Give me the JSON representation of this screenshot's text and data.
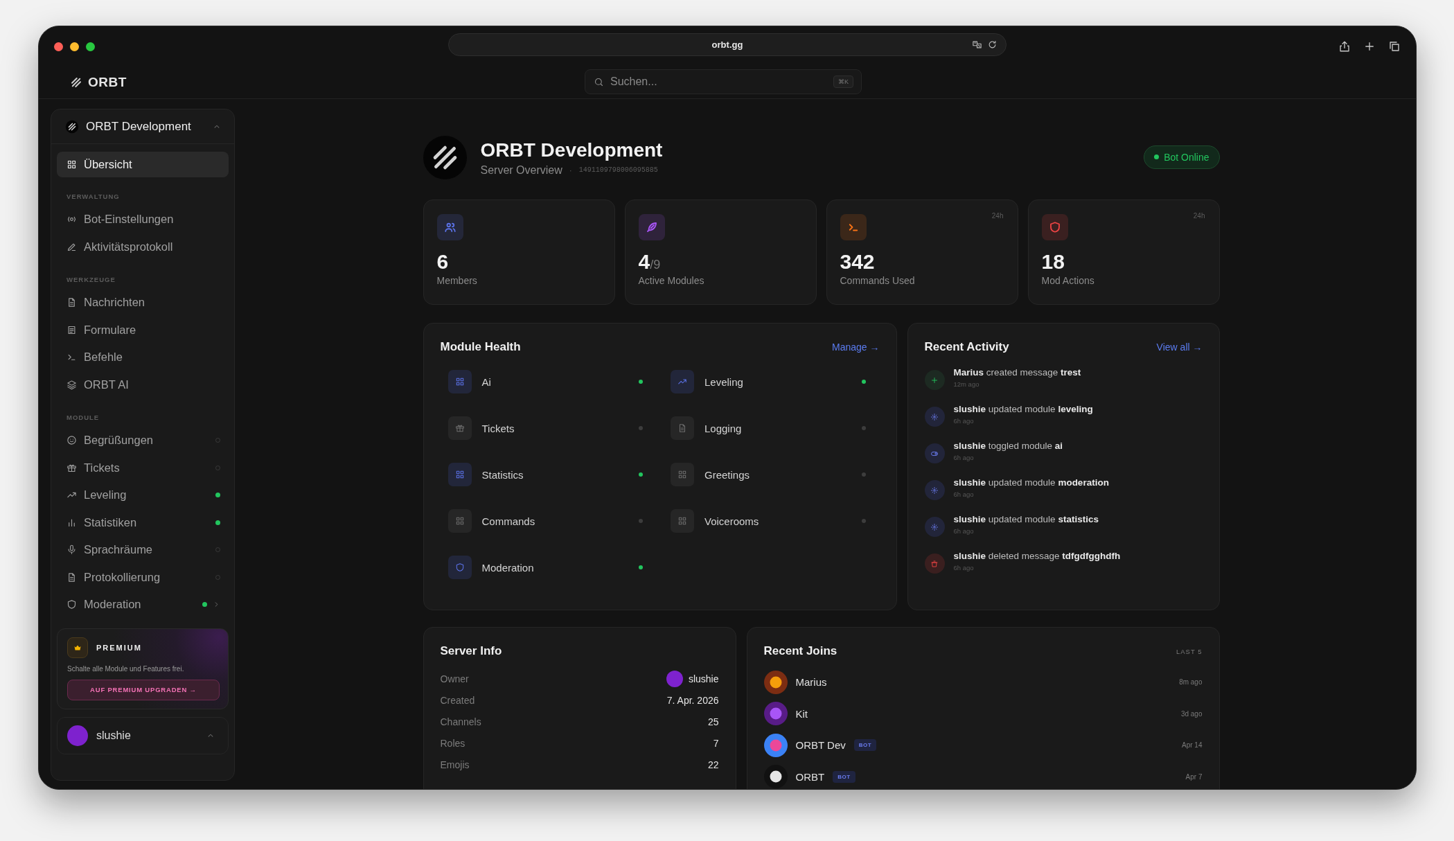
{
  "browser": {
    "url": "orbt.gg"
  },
  "app": {
    "logo": "ORBT",
    "search": {
      "placeholder": "Suchen...",
      "shortcut": "⌘K"
    }
  },
  "sidebar": {
    "server": "ORBT Development",
    "sections": [
      {
        "items": [
          {
            "label": "Übersicht",
            "selected": true
          }
        ]
      },
      {
        "title": "VERWALTUNG",
        "items": [
          {
            "label": "Bot-Einstellungen",
            "selected": false
          },
          {
            "label": "Aktivitätsprotokoll",
            "selected": false
          }
        ]
      },
      {
        "title": "WERKZEUGE",
        "items": [
          {
            "label": "Nachrichten",
            "selected": false
          },
          {
            "label": "Formulare",
            "selected": false
          },
          {
            "label": "Befehle",
            "selected": false
          },
          {
            "label": "ORBT AI",
            "selected": false
          }
        ]
      },
      {
        "title": "MODULE",
        "items": [
          {
            "label": "Begrüßungen",
            "selected": false,
            "active": false,
            "has_submenu": false
          },
          {
            "label": "Tickets",
            "selected": false,
            "active": false,
            "has_submenu": false
          },
          {
            "label": "Leveling",
            "selected": false,
            "active": true,
            "has_submenu": false
          },
          {
            "label": "Statistiken",
            "selected": false,
            "active": true,
            "has_submenu": false
          },
          {
            "label": "Sprachräume",
            "selected": false,
            "active": false,
            "has_submenu": false
          },
          {
            "label": "Protokollierung",
            "selected": false,
            "active": false,
            "has_submenu": false
          },
          {
            "label": "Moderation",
            "selected": false,
            "active": true,
            "has_submenu": true
          }
        ]
      }
    ],
    "premium": {
      "title": "PREMIUM",
      "text": "Schalte alle Module und Features frei.",
      "button": "AUF PREMIUM UPGRADEN →"
    },
    "user": {
      "name": "slushie"
    }
  },
  "header": {
    "title": "ORBT Development",
    "subtitle": "Server Overview",
    "separator": "·",
    "server_id": "1491109798006095885",
    "status": "Bot Online"
  },
  "stats": [
    {
      "value": "6",
      "label": "Members",
      "color": "#5b72e8"
    },
    {
      "value": "4",
      "suffix": "/9",
      "label": "Active Modules",
      "color": "#a855f7"
    },
    {
      "value": "342",
      "label": "Commands Used",
      "color": "#f97316",
      "period": "24h"
    },
    {
      "value": "18",
      "label": "Mod Actions",
      "color": "#ef4444",
      "period": "24h"
    }
  ],
  "module_health": {
    "title": "Module Health",
    "link": "Manage →",
    "modules": [
      {
        "name": "Ai",
        "active": true
      },
      {
        "name": "Leveling",
        "active": true
      },
      {
        "name": "Tickets",
        "active": false
      },
      {
        "name": "Logging",
        "active": false
      },
      {
        "name": "Statistics",
        "active": true
      },
      {
        "name": "Greetings",
        "active": false
      },
      {
        "name": "Commands",
        "active": false
      },
      {
        "name": "Voicerooms",
        "active": false
      },
      {
        "name": "Moderation",
        "active": true
      }
    ]
  },
  "recent_activity": {
    "title": "Recent Activity",
    "link": "View all →",
    "items": [
      {
        "kind": "create",
        "text": "**Marius** created message **trest**",
        "time": "12m ago"
      },
      {
        "kind": "update",
        "text": "**slushie** updated module **leveling**",
        "time": "6h ago"
      },
      {
        "kind": "toggle",
        "text": "**slushie** toggled module **ai**",
        "time": "6h ago"
      },
      {
        "kind": "update",
        "text": "**slushie** updated module **moderation**",
        "time": "6h ago"
      },
      {
        "kind": "update",
        "text": "**slushie** updated module **statistics**",
        "time": "6h ago"
      },
      {
        "kind": "delete",
        "text": "**slushie** deleted message **tdfgdfgghdfh**",
        "time": "6h ago"
      }
    ]
  },
  "server_info": {
    "title": "Server Info",
    "rows": [
      {
        "label": "Owner",
        "value": "slushie",
        "kind": "user"
      },
      {
        "label": "Created",
        "value": "7. Apr. 2026",
        "kind": "text"
      },
      {
        "label": "Channels",
        "value": "25",
        "kind": "text"
      },
      {
        "label": "Roles",
        "value": "7",
        "kind": "text"
      },
      {
        "label": "Emojis",
        "value": "22",
        "kind": "text"
      }
    ]
  },
  "recent_joins": {
    "title": "Recent Joins",
    "note": "LAST 5",
    "members": [
      {
        "name": "Marius",
        "bot": false,
        "time": "8m ago"
      },
      {
        "name": "Kit",
        "bot": false,
        "time": "3d ago"
      },
      {
        "name": "ORBT Dev",
        "bot": true,
        "badge": "BOT",
        "time": "Apr 14"
      },
      {
        "name": "ORBT",
        "bot": true,
        "badge": "BOT",
        "time": "Apr 7"
      }
    ]
  }
}
